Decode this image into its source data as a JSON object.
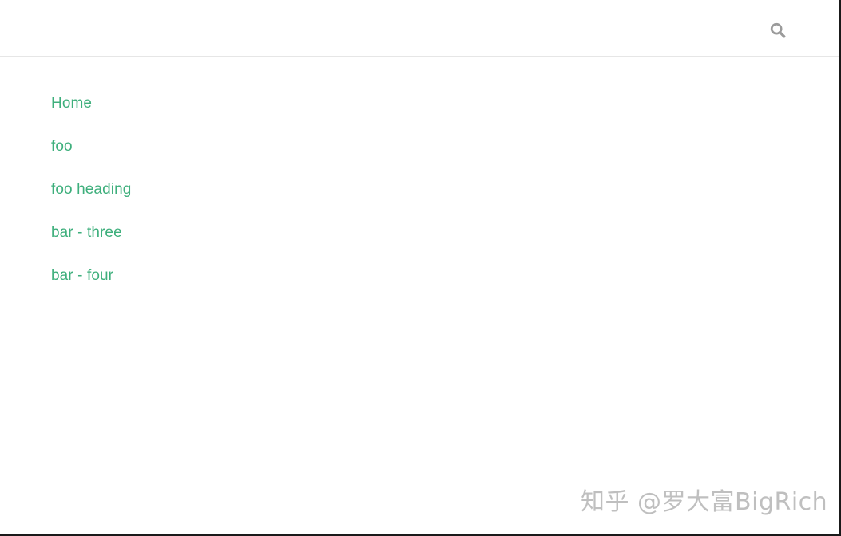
{
  "navbar": {
    "search_icon": "search-icon"
  },
  "sidebar": {
    "links": [
      {
        "label": "Home"
      },
      {
        "label": "foo"
      },
      {
        "label": "foo heading"
      },
      {
        "label": "bar - three"
      },
      {
        "label": "bar - four"
      }
    ]
  },
  "watermark": {
    "text": "知乎 @罗大富BigRich"
  },
  "colors": {
    "accent": "#3eaf7c",
    "icon": "#999999",
    "border": "#e6e6e6"
  }
}
